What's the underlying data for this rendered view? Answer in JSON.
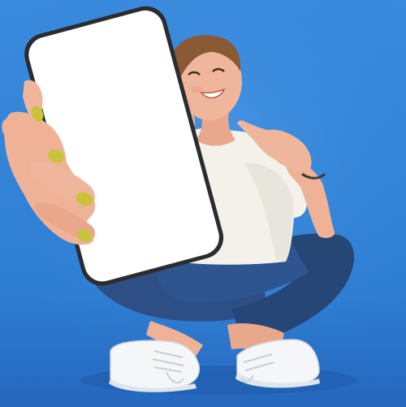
{
  "photo": {
    "background_color": "#2e7fd4",
    "floor_color": "#2a74c6",
    "skin_color": "#efb296",
    "hair_color": "#8a5a34",
    "shirt_color": "#f3f1ea",
    "jeans_color": "#2d4f86",
    "sneaker_color": "#f4f6f8",
    "nail_color": "#c9c23a",
    "phone_frame_color": "#2a2c30",
    "phone_screen_color": "#ffffff"
  }
}
